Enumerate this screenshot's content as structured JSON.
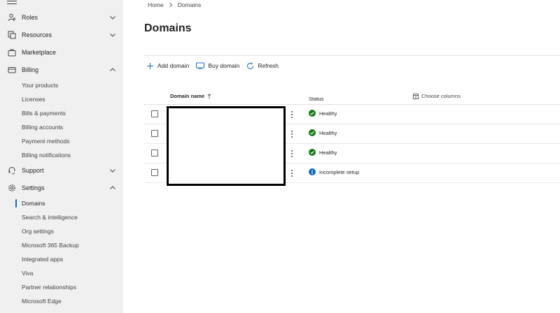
{
  "sidebar": {
    "groups": {
      "roles": {
        "label": "Roles",
        "icon": "person-key-icon"
      },
      "resources": {
        "label": "Resources",
        "icon": "resources-icon"
      },
      "marketplace": {
        "label": "Marketplace",
        "icon": "shopping-bag-icon"
      },
      "billing": {
        "label": "Billing",
        "icon": "credit-card-icon"
      },
      "support": {
        "label": "Support",
        "icon": "headset-icon"
      },
      "settings": {
        "label": "Settings",
        "icon": "gear-icon"
      }
    },
    "billing_items": [
      "Your products",
      "Licenses",
      "Bills & payments",
      "Billing accounts",
      "Payment methods",
      "Billing notifications"
    ],
    "settings_items": [
      "Domains",
      "Search & intelligence",
      "Org settings",
      "Microsoft 365 Backup",
      "Integrated apps",
      "Viva",
      "Partner relationships",
      "Microsoft Edge"
    ],
    "active_item": "Domains"
  },
  "breadcrumb": {
    "home": "Home",
    "current": "Domains"
  },
  "page": {
    "title": "Domains"
  },
  "commands": {
    "add": "Add domain",
    "buy": "Buy domain",
    "refresh": "Refresh"
  },
  "table": {
    "columns": {
      "name": "Domain name",
      "status": "Status",
      "choose": "Choose columns"
    },
    "rows": [
      {
        "name": "",
        "status": "Healthy",
        "status_type": "success"
      },
      {
        "name": "",
        "status": "Healthy",
        "status_type": "success"
      },
      {
        "name": "",
        "status": "Healthy",
        "status_type": "success"
      },
      {
        "name": "",
        "status": "Incomplete setup",
        "status_type": "info"
      }
    ]
  },
  "colors": {
    "accent": "#0f6cbd",
    "success": "#107c10",
    "info": "#0f6cbd",
    "sidebar_bg": "#f0f0f0"
  }
}
